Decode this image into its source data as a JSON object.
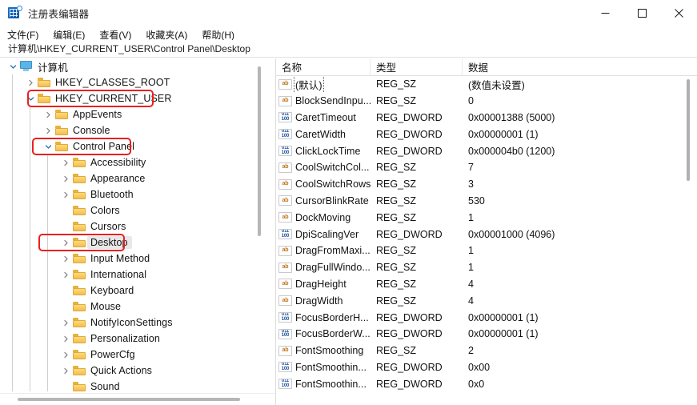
{
  "window": {
    "title": "注册表编辑器",
    "app_icon": "registry-editor-icon",
    "controls": {
      "minimize": "minimize-icon",
      "maximize": "maximize-icon",
      "close": "close-icon"
    }
  },
  "menubar": {
    "items": [
      {
        "label": "文件(F)"
      },
      {
        "label": "编辑(E)"
      },
      {
        "label": "查看(V)"
      },
      {
        "label": "收藏夹(A)"
      },
      {
        "label": "帮助(H)"
      }
    ]
  },
  "address": {
    "path": "计算机\\HKEY_CURRENT_USER\\Control Panel\\Desktop"
  },
  "tree": {
    "items": [
      {
        "label": "计算机",
        "depth": 0,
        "expander": "expanded",
        "icon": "computer-icon",
        "highlight": false,
        "selected": false
      },
      {
        "label": "HKEY_CLASSES_ROOT",
        "depth": 1,
        "expander": "collapsed",
        "icon": "folder-icon",
        "highlight": false,
        "selected": false
      },
      {
        "label": "HKEY_CURRENT_USER",
        "depth": 1,
        "expander": "expanded",
        "icon": "folder-icon",
        "highlight": true,
        "selected": false
      },
      {
        "label": "AppEvents",
        "depth": 2,
        "expander": "collapsed",
        "icon": "folder-icon",
        "highlight": false,
        "selected": false
      },
      {
        "label": "Console",
        "depth": 2,
        "expander": "collapsed",
        "icon": "folder-icon",
        "highlight": false,
        "selected": false
      },
      {
        "label": "Control Panel",
        "depth": 2,
        "expander": "expanded",
        "icon": "folder-icon",
        "highlight": true,
        "selected": false
      },
      {
        "label": "Accessibility",
        "depth": 3,
        "expander": "collapsed",
        "icon": "folder-icon",
        "highlight": false,
        "selected": false
      },
      {
        "label": "Appearance",
        "depth": 3,
        "expander": "collapsed",
        "icon": "folder-icon",
        "highlight": false,
        "selected": false
      },
      {
        "label": "Bluetooth",
        "depth": 3,
        "expander": "collapsed",
        "icon": "folder-icon",
        "highlight": false,
        "selected": false
      },
      {
        "label": "Colors",
        "depth": 3,
        "expander": "none",
        "icon": "folder-icon",
        "highlight": false,
        "selected": false
      },
      {
        "label": "Cursors",
        "depth": 3,
        "expander": "none",
        "icon": "folder-icon",
        "highlight": false,
        "selected": false
      },
      {
        "label": "Desktop",
        "depth": 3,
        "expander": "collapsed",
        "icon": "folder-icon",
        "highlight": true,
        "selected": true
      },
      {
        "label": "Input Method",
        "depth": 3,
        "expander": "collapsed",
        "icon": "folder-icon",
        "highlight": false,
        "selected": false
      },
      {
        "label": "International",
        "depth": 3,
        "expander": "collapsed",
        "icon": "folder-icon",
        "highlight": false,
        "selected": false
      },
      {
        "label": "Keyboard",
        "depth": 3,
        "expander": "none",
        "icon": "folder-icon",
        "highlight": false,
        "selected": false
      },
      {
        "label": "Mouse",
        "depth": 3,
        "expander": "none",
        "icon": "folder-icon",
        "highlight": false,
        "selected": false
      },
      {
        "label": "NotifyIconSettings",
        "depth": 3,
        "expander": "collapsed",
        "icon": "folder-icon",
        "highlight": false,
        "selected": false
      },
      {
        "label": "Personalization",
        "depth": 3,
        "expander": "collapsed",
        "icon": "folder-icon",
        "highlight": false,
        "selected": false
      },
      {
        "label": "PowerCfg",
        "depth": 3,
        "expander": "collapsed",
        "icon": "folder-icon",
        "highlight": false,
        "selected": false
      },
      {
        "label": "Quick Actions",
        "depth": 3,
        "expander": "collapsed",
        "icon": "folder-icon",
        "highlight": false,
        "selected": false
      },
      {
        "label": "Sound",
        "depth": 3,
        "expander": "none",
        "icon": "folder-icon",
        "highlight": false,
        "selected": false
      }
    ]
  },
  "list": {
    "columns": [
      {
        "label": "名称"
      },
      {
        "label": "类型"
      },
      {
        "label": "数据"
      }
    ],
    "rows": [
      {
        "name": "(默认)",
        "type": "REG_SZ",
        "data": "(数值未设置)",
        "icon": "string-value-icon",
        "focused": true
      },
      {
        "name": "BlockSendInpu...",
        "type": "REG_SZ",
        "data": "0",
        "icon": "string-value-icon",
        "focused": false
      },
      {
        "name": "CaretTimeout",
        "type": "REG_DWORD",
        "data": "0x00001388 (5000)",
        "icon": "dword-value-icon",
        "focused": false
      },
      {
        "name": "CaretWidth",
        "type": "REG_DWORD",
        "data": "0x00000001 (1)",
        "icon": "dword-value-icon",
        "focused": false
      },
      {
        "name": "ClickLockTime",
        "type": "REG_DWORD",
        "data": "0x000004b0 (1200)",
        "icon": "dword-value-icon",
        "focused": false
      },
      {
        "name": "CoolSwitchCol...",
        "type": "REG_SZ",
        "data": "7",
        "icon": "string-value-icon",
        "focused": false
      },
      {
        "name": "CoolSwitchRows",
        "type": "REG_SZ",
        "data": "3",
        "icon": "string-value-icon",
        "focused": false
      },
      {
        "name": "CursorBlinkRate",
        "type": "REG_SZ",
        "data": "530",
        "icon": "string-value-icon",
        "focused": false
      },
      {
        "name": "DockMoving",
        "type": "REG_SZ",
        "data": "1",
        "icon": "string-value-icon",
        "focused": false
      },
      {
        "name": "DpiScalingVer",
        "type": "REG_DWORD",
        "data": "0x00001000 (4096)",
        "icon": "dword-value-icon",
        "focused": false
      },
      {
        "name": "DragFromMaxi...",
        "type": "REG_SZ",
        "data": "1",
        "icon": "string-value-icon",
        "focused": false
      },
      {
        "name": "DragFullWindo...",
        "type": "REG_SZ",
        "data": "1",
        "icon": "string-value-icon",
        "focused": false
      },
      {
        "name": "DragHeight",
        "type": "REG_SZ",
        "data": "4",
        "icon": "string-value-icon",
        "focused": false
      },
      {
        "name": "DragWidth",
        "type": "REG_SZ",
        "data": "4",
        "icon": "string-value-icon",
        "focused": false
      },
      {
        "name": "FocusBorderH...",
        "type": "REG_DWORD",
        "data": "0x00000001 (1)",
        "icon": "dword-value-icon",
        "focused": false
      },
      {
        "name": "FocusBorderW...",
        "type": "REG_DWORD",
        "data": "0x00000001 (1)",
        "icon": "dword-value-icon",
        "focused": false
      },
      {
        "name": "FontSmoothing",
        "type": "REG_SZ",
        "data": "2",
        "icon": "string-value-icon",
        "focused": false
      },
      {
        "name": "FontSmoothin...",
        "type": "REG_DWORD",
        "data": "0x00",
        "icon": "dword-value-icon",
        "focused": false
      },
      {
        "name": "FontSmoothin...",
        "type": "REG_DWORD",
        "data": "0x0",
        "icon": "dword-value-icon",
        "focused": false
      }
    ]
  },
  "colors": {
    "annotation": "#e8201f",
    "folder": "#f0bf52",
    "selection": "#e8e8e8"
  }
}
